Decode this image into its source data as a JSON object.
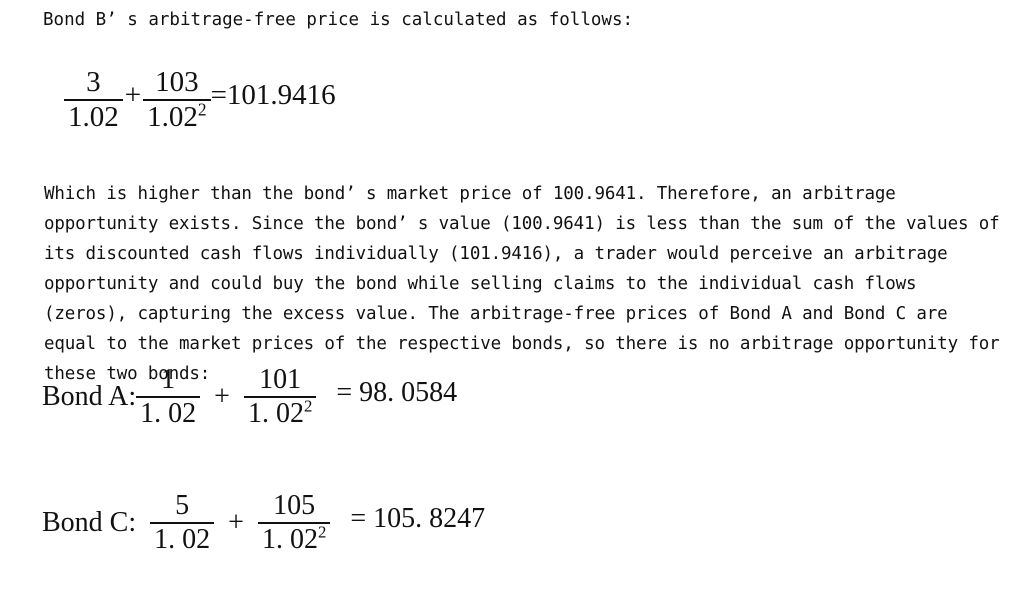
{
  "intro": "Bond B’ s arbitrage-free price is calculated as follows:",
  "eq_b": {
    "t1_num": "3",
    "t1_den": "1.02",
    "plus": "+",
    "t2_num": "103",
    "t2_den": "1.02",
    "exp": "2",
    "result": "=101.9416"
  },
  "paragraph": "Which is higher than the bond’ s market price of 100.9641. Therefore, an arbitrage opportunity exists. Since the bond’ s value (100.9641) is less than the sum of the values of its discounted cash flows individually (101.9416), a trader would perceive an arbitrage opportunity and could buy the bond while selling claims to the individual cash flows (zeros), capturing the excess value. The arbitrage-free prices of Bond A and Bond C are equal to the market prices of the respective bonds, so there is no arbitrage opportunity for these two bonds:",
  "eq_a": {
    "label": "Bond A:",
    "t1_num": "1",
    "t1_den": "1. 02",
    "plus": "+",
    "t2_num": "101",
    "t2_den": "1. 02",
    "exp": "2",
    "result": "= 98. 0584"
  },
  "eq_c": {
    "label": "Bond C:",
    "t1_num": "5",
    "t1_den": "1. 02",
    "plus": "+",
    "t2_num": "105",
    "t2_den": "1. 02",
    "exp": "2",
    "result": "= 105. 8247"
  }
}
